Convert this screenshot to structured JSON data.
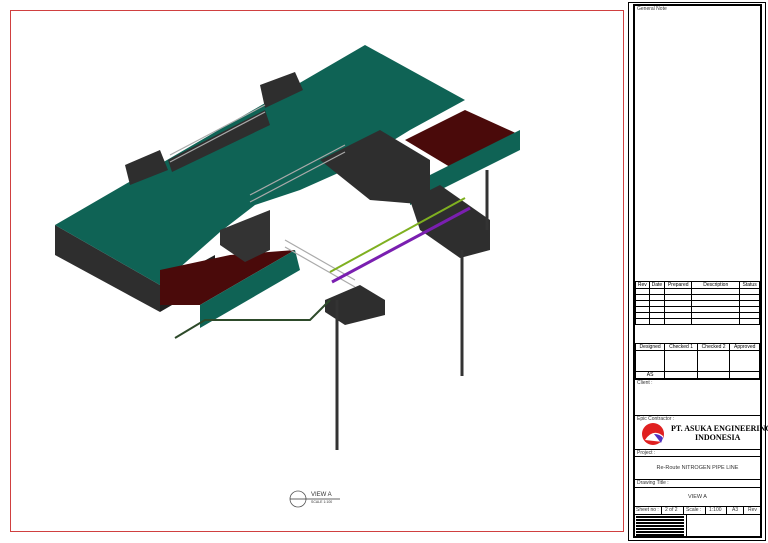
{
  "drawing": {
    "view_label": "VIEW A",
    "view_scale": "SCALE 1:100"
  },
  "title_block": {
    "general_note_label": "General Note",
    "revision_headers": [
      "Rev",
      "Date",
      "Prepared",
      "Description",
      "Status"
    ],
    "approval_headers": [
      "Designed",
      "Checked 1",
      "Checked 2",
      "Approved"
    ],
    "designed_by": "AS",
    "client_label": "Client :",
    "contractor_label": "Epic Contractor :",
    "company_name_line1": "PT. ASUKA ENGINEERING",
    "company_name_line2": "INDONESIA",
    "project_label": "Project :",
    "project_name": "Re-Route NITROGEN PIPE LINE",
    "drawing_title_label": "Drawing Title :",
    "drawing_title": "VIEW A",
    "sheet_label": "Sheet no :",
    "sheet_value": "2 of 2",
    "scale_label": "Scale :",
    "scale_value": "1:100",
    "paper_size": "A3",
    "rev_label": "Rev"
  },
  "colors": {
    "slab": "#0f6355",
    "side": "#2e2e2e",
    "floor": "#4a0a0a",
    "pipe_purple": "#7a1fb0",
    "pipe_green": "#7fb020",
    "frame": "#d04040"
  }
}
